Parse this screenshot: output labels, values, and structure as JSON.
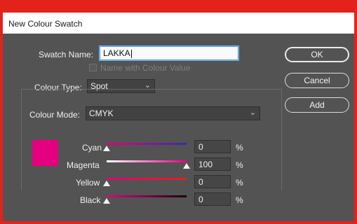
{
  "window": {
    "title": "New Colour Swatch"
  },
  "form": {
    "swatch_name_label": "Swatch Name:",
    "swatch_name_value": "LAKKA",
    "name_with_value_label": "Name with Colour Value",
    "colour_type_label": "Colour Type:",
    "colour_type_value": "Spot",
    "colour_mode_label": "Colour Mode:",
    "colour_mode_value": "CMYK"
  },
  "buttons": {
    "ok": "OK",
    "cancel": "Cancel",
    "add": "Add"
  },
  "preview_color": "#e4007f",
  "channels": [
    {
      "label": "Cyan",
      "value": "0",
      "unit": "%"
    },
    {
      "label": "Magenta",
      "value": "100",
      "unit": "%"
    },
    {
      "label": "Yellow",
      "value": "0",
      "unit": "%"
    },
    {
      "label": "Black",
      "value": "0",
      "unit": "%"
    }
  ]
}
